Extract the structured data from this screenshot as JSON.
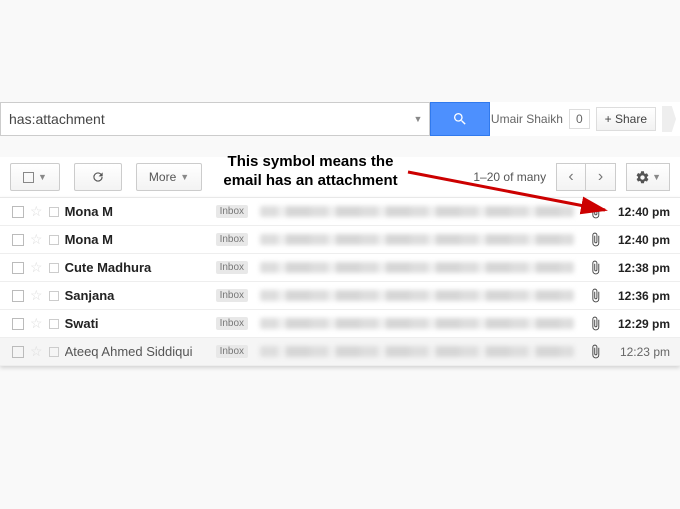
{
  "search": {
    "value": "has:attachment"
  },
  "user": {
    "name": "Umair Shaikh",
    "count": "0",
    "share_label": "+ Share"
  },
  "toolbar": {
    "more_label": "More",
    "page_info": "1–20 of many"
  },
  "inbox_label": "Inbox",
  "annotation": {
    "text": "This symbol means the email has an attachment"
  },
  "rows": [
    {
      "sender": "Mona M",
      "read": false,
      "time": "12:40 pm"
    },
    {
      "sender": "Mona M",
      "read": false,
      "time": "12:40 pm"
    },
    {
      "sender": "Cute Madhura",
      "read": false,
      "time": "12:38 pm"
    },
    {
      "sender": "Sanjana",
      "read": false,
      "time": "12:36 pm"
    },
    {
      "sender": "Swati",
      "read": false,
      "time": "12:29 pm"
    },
    {
      "sender": "Ateeq Ahmed Siddiqui",
      "read": true,
      "time": "12:23 pm"
    }
  ]
}
